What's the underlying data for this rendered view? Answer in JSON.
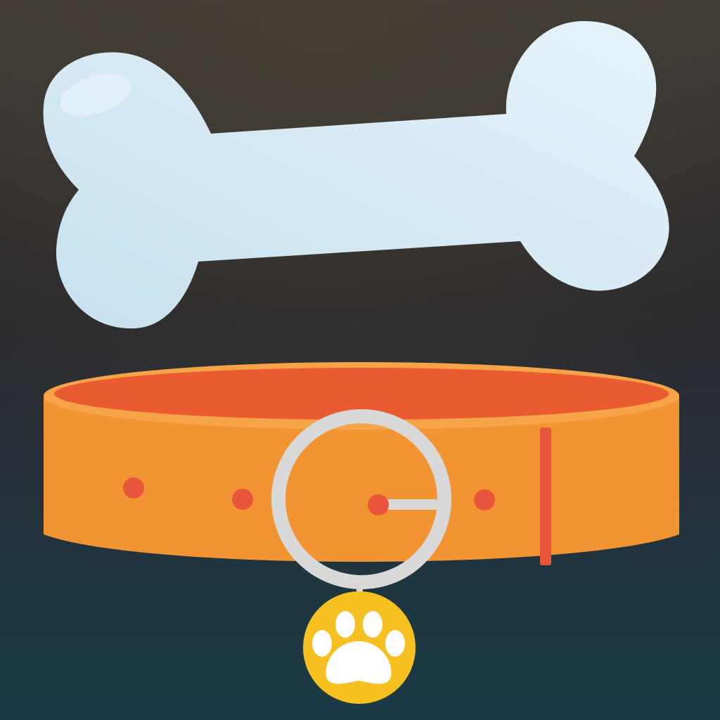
{
  "image": {
    "kind": "flat pet icon",
    "elements": [
      "bone-icon",
      "dog-collar-icon",
      "buckle-icon",
      "paw-tag-icon"
    ]
  },
  "colors": {
    "background_top": "#3f3b35",
    "background_bottom": "#1b3a45",
    "bone_light": "#e6f3fb",
    "bone_shade": "#c6e1ee",
    "collar_body": "#f39433",
    "collar_rim": "#f7a448",
    "collar_inner": "#ea5b31",
    "collar_holes": "#e9553a",
    "buckle": "#d9d9d9",
    "tag": "#f6c120",
    "paw": "#ffffff"
  }
}
